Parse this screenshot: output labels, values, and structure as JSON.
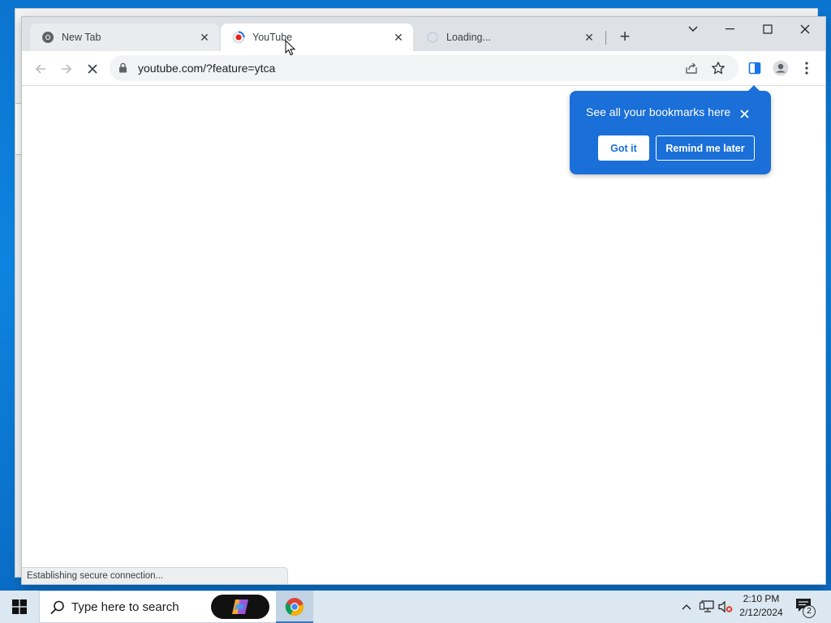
{
  "browser": {
    "tabs": [
      {
        "title": "New Tab",
        "favicon": "chrome-icon",
        "state": "inactive"
      },
      {
        "title": "YouTube",
        "favicon": "youtube-loading-icon",
        "state": "active"
      },
      {
        "title": "Loading...",
        "favicon": "loading-spinner-icon",
        "state": "inactive"
      }
    ],
    "new_tab_symbol": "+",
    "address": {
      "url": "youtube.com/?feature=ytca"
    },
    "status_text": "Establishing secure connection..."
  },
  "bookmark_bubble": {
    "message": "See all your bookmarks here",
    "got_it_label": "Got it",
    "remind_label": "Remind me later"
  },
  "taskbar": {
    "search_placeholder": "Type here to search",
    "time": "2:10 PM",
    "date": "2/12/2024",
    "notification_count": "2"
  },
  "colors": {
    "accent": "#1a6fd8",
    "desktop": "#0a78d4",
    "tab_strip": "#dee1e6",
    "taskbar": "#dbe7f1"
  }
}
